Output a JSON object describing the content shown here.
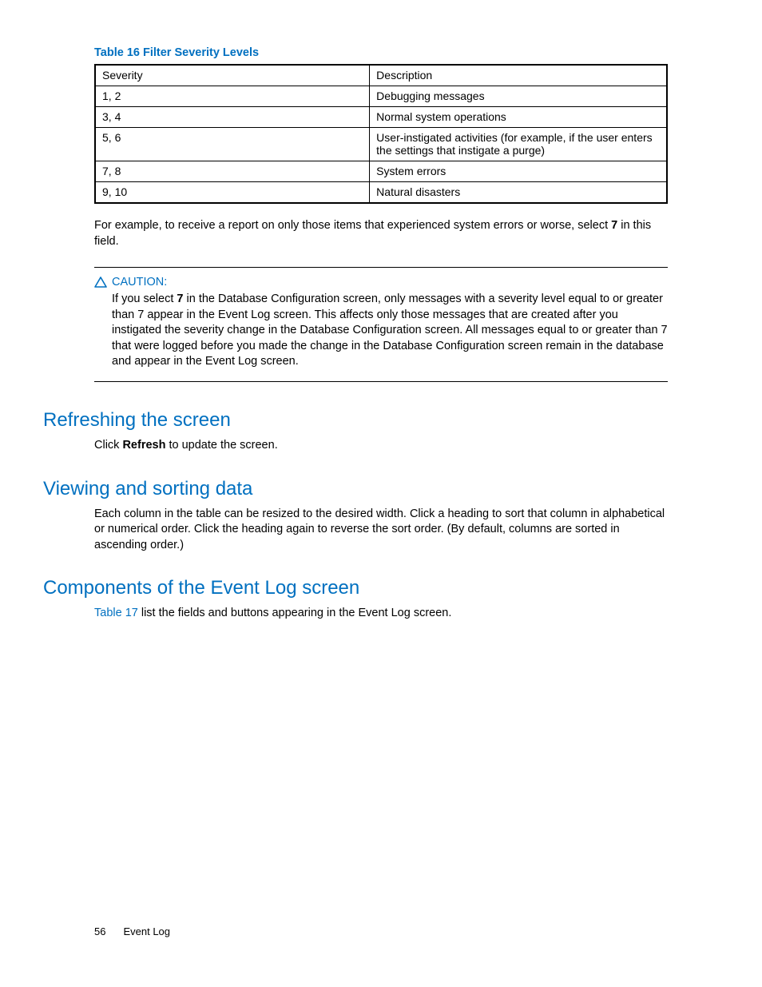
{
  "table": {
    "title": "Table 16 Filter Severity Levels",
    "headers": [
      "Severity",
      "Description"
    ],
    "rows": [
      {
        "sev": "1, 2",
        "desc": "Debugging messages"
      },
      {
        "sev": "3, 4",
        "desc": "Normal system operations"
      },
      {
        "sev": "5, 6",
        "desc": "User-instigated activities (for example, if the user enters the settings that instigate a purge)"
      },
      {
        "sev": "7, 8",
        "desc": "System errors"
      },
      {
        "sev": "9, 10",
        "desc": "Natural disasters"
      }
    ]
  },
  "example": {
    "pre": "For example, to receive a report on only those items that experienced system errors or worse, select ",
    "bold": "7",
    "post": " in this field."
  },
  "caution": {
    "label": "CAUTION:",
    "pre": "If you select ",
    "bold": "7",
    "post": " in the Database Configuration screen, only messages with a severity level equal to or greater than 7 appear in the Event Log screen. This affects only those messages that are created after you instigated the severity change in the Database Configuration screen. All messages equal to or greater than 7 that were logged before you made the change in the Database Configuration screen remain in the database and appear in the Event Log screen."
  },
  "sections": {
    "refresh": {
      "title": "Refreshing the screen",
      "pre": "Click ",
      "bold": "Refresh",
      "post": " to update the screen."
    },
    "viewsort": {
      "title": "Viewing and sorting data",
      "body": "Each column in the table can be resized to the desired width. Click a heading to sort that column in alphabetical or numerical order. Click the heading again to reverse the sort order. (By default, columns are sorted in ascending order.)"
    },
    "components": {
      "title": "Components of the Event Log screen",
      "link": "Table 17",
      "post": " list the fields and buttons appearing in the Event Log screen."
    }
  },
  "footer": {
    "page": "56",
    "section": "Event Log"
  }
}
